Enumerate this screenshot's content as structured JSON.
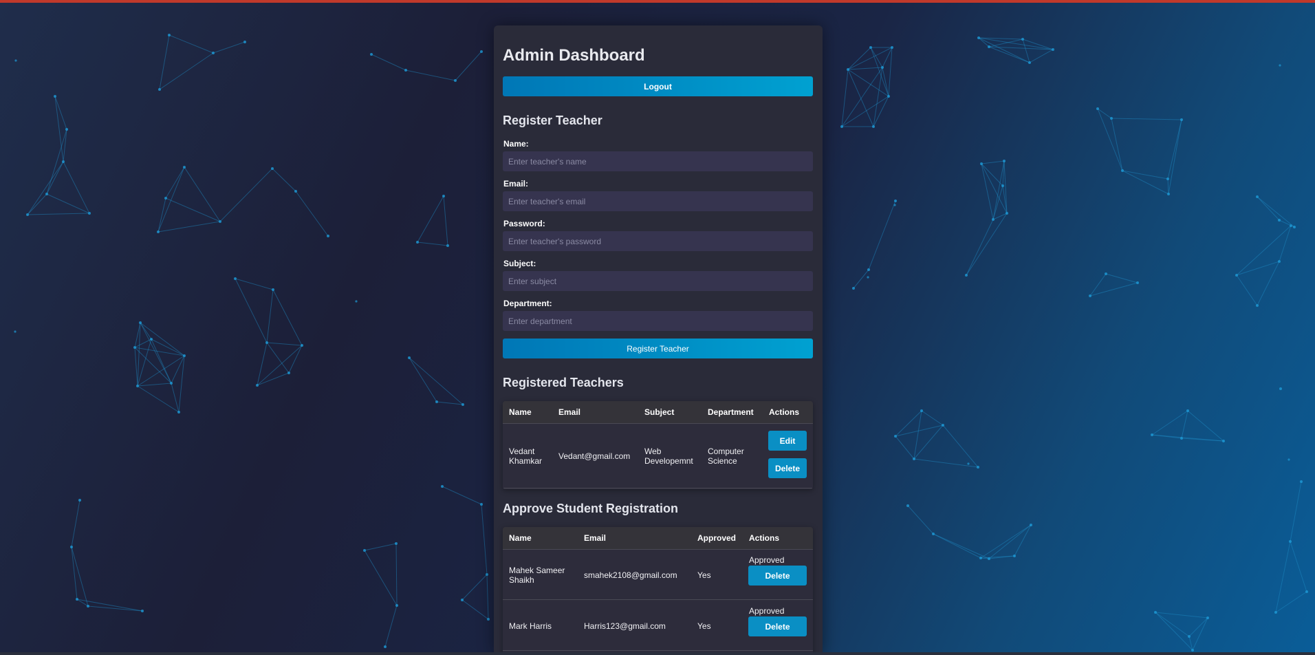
{
  "page": {
    "title": "Admin Dashboard",
    "logout_label": "Logout"
  },
  "register_form": {
    "heading": "Register Teacher",
    "fields": [
      {
        "label": "Name:",
        "placeholder": "Enter teacher's name",
        "value": ""
      },
      {
        "label": "Email:",
        "placeholder": "Enter teacher's email",
        "value": ""
      },
      {
        "label": "Password:",
        "placeholder": "Enter teacher's password",
        "value": ""
      },
      {
        "label": "Subject:",
        "placeholder": "Enter subject",
        "value": ""
      },
      {
        "label": "Department:",
        "placeholder": "Enter department",
        "value": ""
      }
    ],
    "submit_label": "Register Teacher"
  },
  "teachers": {
    "heading": "Registered Teachers",
    "columns": [
      "Name",
      "Email",
      "Subject",
      "Department",
      "Actions"
    ],
    "rows": [
      {
        "name": [
          "Vedant",
          "Khamkar"
        ],
        "email": "Vedant@gmail.com",
        "subject": [
          "Web",
          "Developemnt"
        ],
        "department": [
          "Computer",
          "Science"
        ],
        "edit_label": "Edit",
        "delete_label": "Delete"
      }
    ]
  },
  "students": {
    "heading": "Approve Student Registration",
    "columns": [
      "Name",
      "Email",
      "Approved",
      "Actions"
    ],
    "rows": [
      {
        "name": [
          "Mahek Sameer",
          "Shaikh"
        ],
        "email": "smahek2108@gmail.com",
        "approved": "Yes",
        "status": "Approved",
        "delete_label": "Delete"
      },
      {
        "name": [
          "Mark Harris",
          ""
        ],
        "email": "Harris123@gmail.com",
        "approved": "Yes",
        "status": "Approved",
        "delete_label": "Delete"
      }
    ]
  },
  "theme": {
    "accent": "#00a1d1",
    "accent_dark": "#0077b6",
    "panel": "#2a2b39",
    "top_bar": "#c0392b"
  }
}
